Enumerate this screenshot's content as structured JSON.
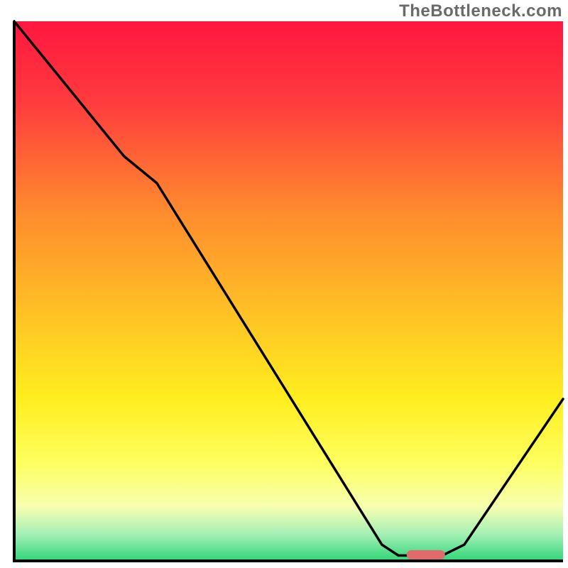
{
  "watermark": "TheBottleneck.com",
  "chart_data": {
    "type": "line",
    "title": "",
    "xlabel": "",
    "ylabel": "",
    "xlim": [
      0,
      100
    ],
    "ylim": [
      0,
      100
    ],
    "grid": false,
    "background_gradient": {
      "stops": [
        {
          "offset": 0,
          "color": "#ff173f"
        },
        {
          "offset": 15,
          "color": "#ff3b3e"
        },
        {
          "offset": 35,
          "color": "#ff8a2e"
        },
        {
          "offset": 55,
          "color": "#ffc425"
        },
        {
          "offset": 70,
          "color": "#ffee1f"
        },
        {
          "offset": 82,
          "color": "#feff60"
        },
        {
          "offset": 90,
          "color": "#f6ffb0"
        },
        {
          "offset": 95,
          "color": "#a5f0b5"
        },
        {
          "offset": 100,
          "color": "#2fd67a"
        }
      ]
    },
    "series": [
      {
        "name": "bottleneck-curve",
        "stroke": "#000000",
        "points": [
          {
            "x": 0,
            "y": 100
          },
          {
            "x": 20,
            "y": 75
          },
          {
            "x": 26,
            "y": 70
          },
          {
            "x": 67,
            "y": 3
          },
          {
            "x": 70,
            "y": 1
          },
          {
            "x": 78,
            "y": 1
          },
          {
            "x": 82,
            "y": 3
          },
          {
            "x": 100,
            "y": 30
          }
        ]
      }
    ],
    "marker": {
      "name": "optimal-range",
      "x_center": 75,
      "y": 1.2,
      "width": 7,
      "color": "#e36a6a"
    },
    "axis": {
      "color": "#000000",
      "width": 4
    }
  }
}
